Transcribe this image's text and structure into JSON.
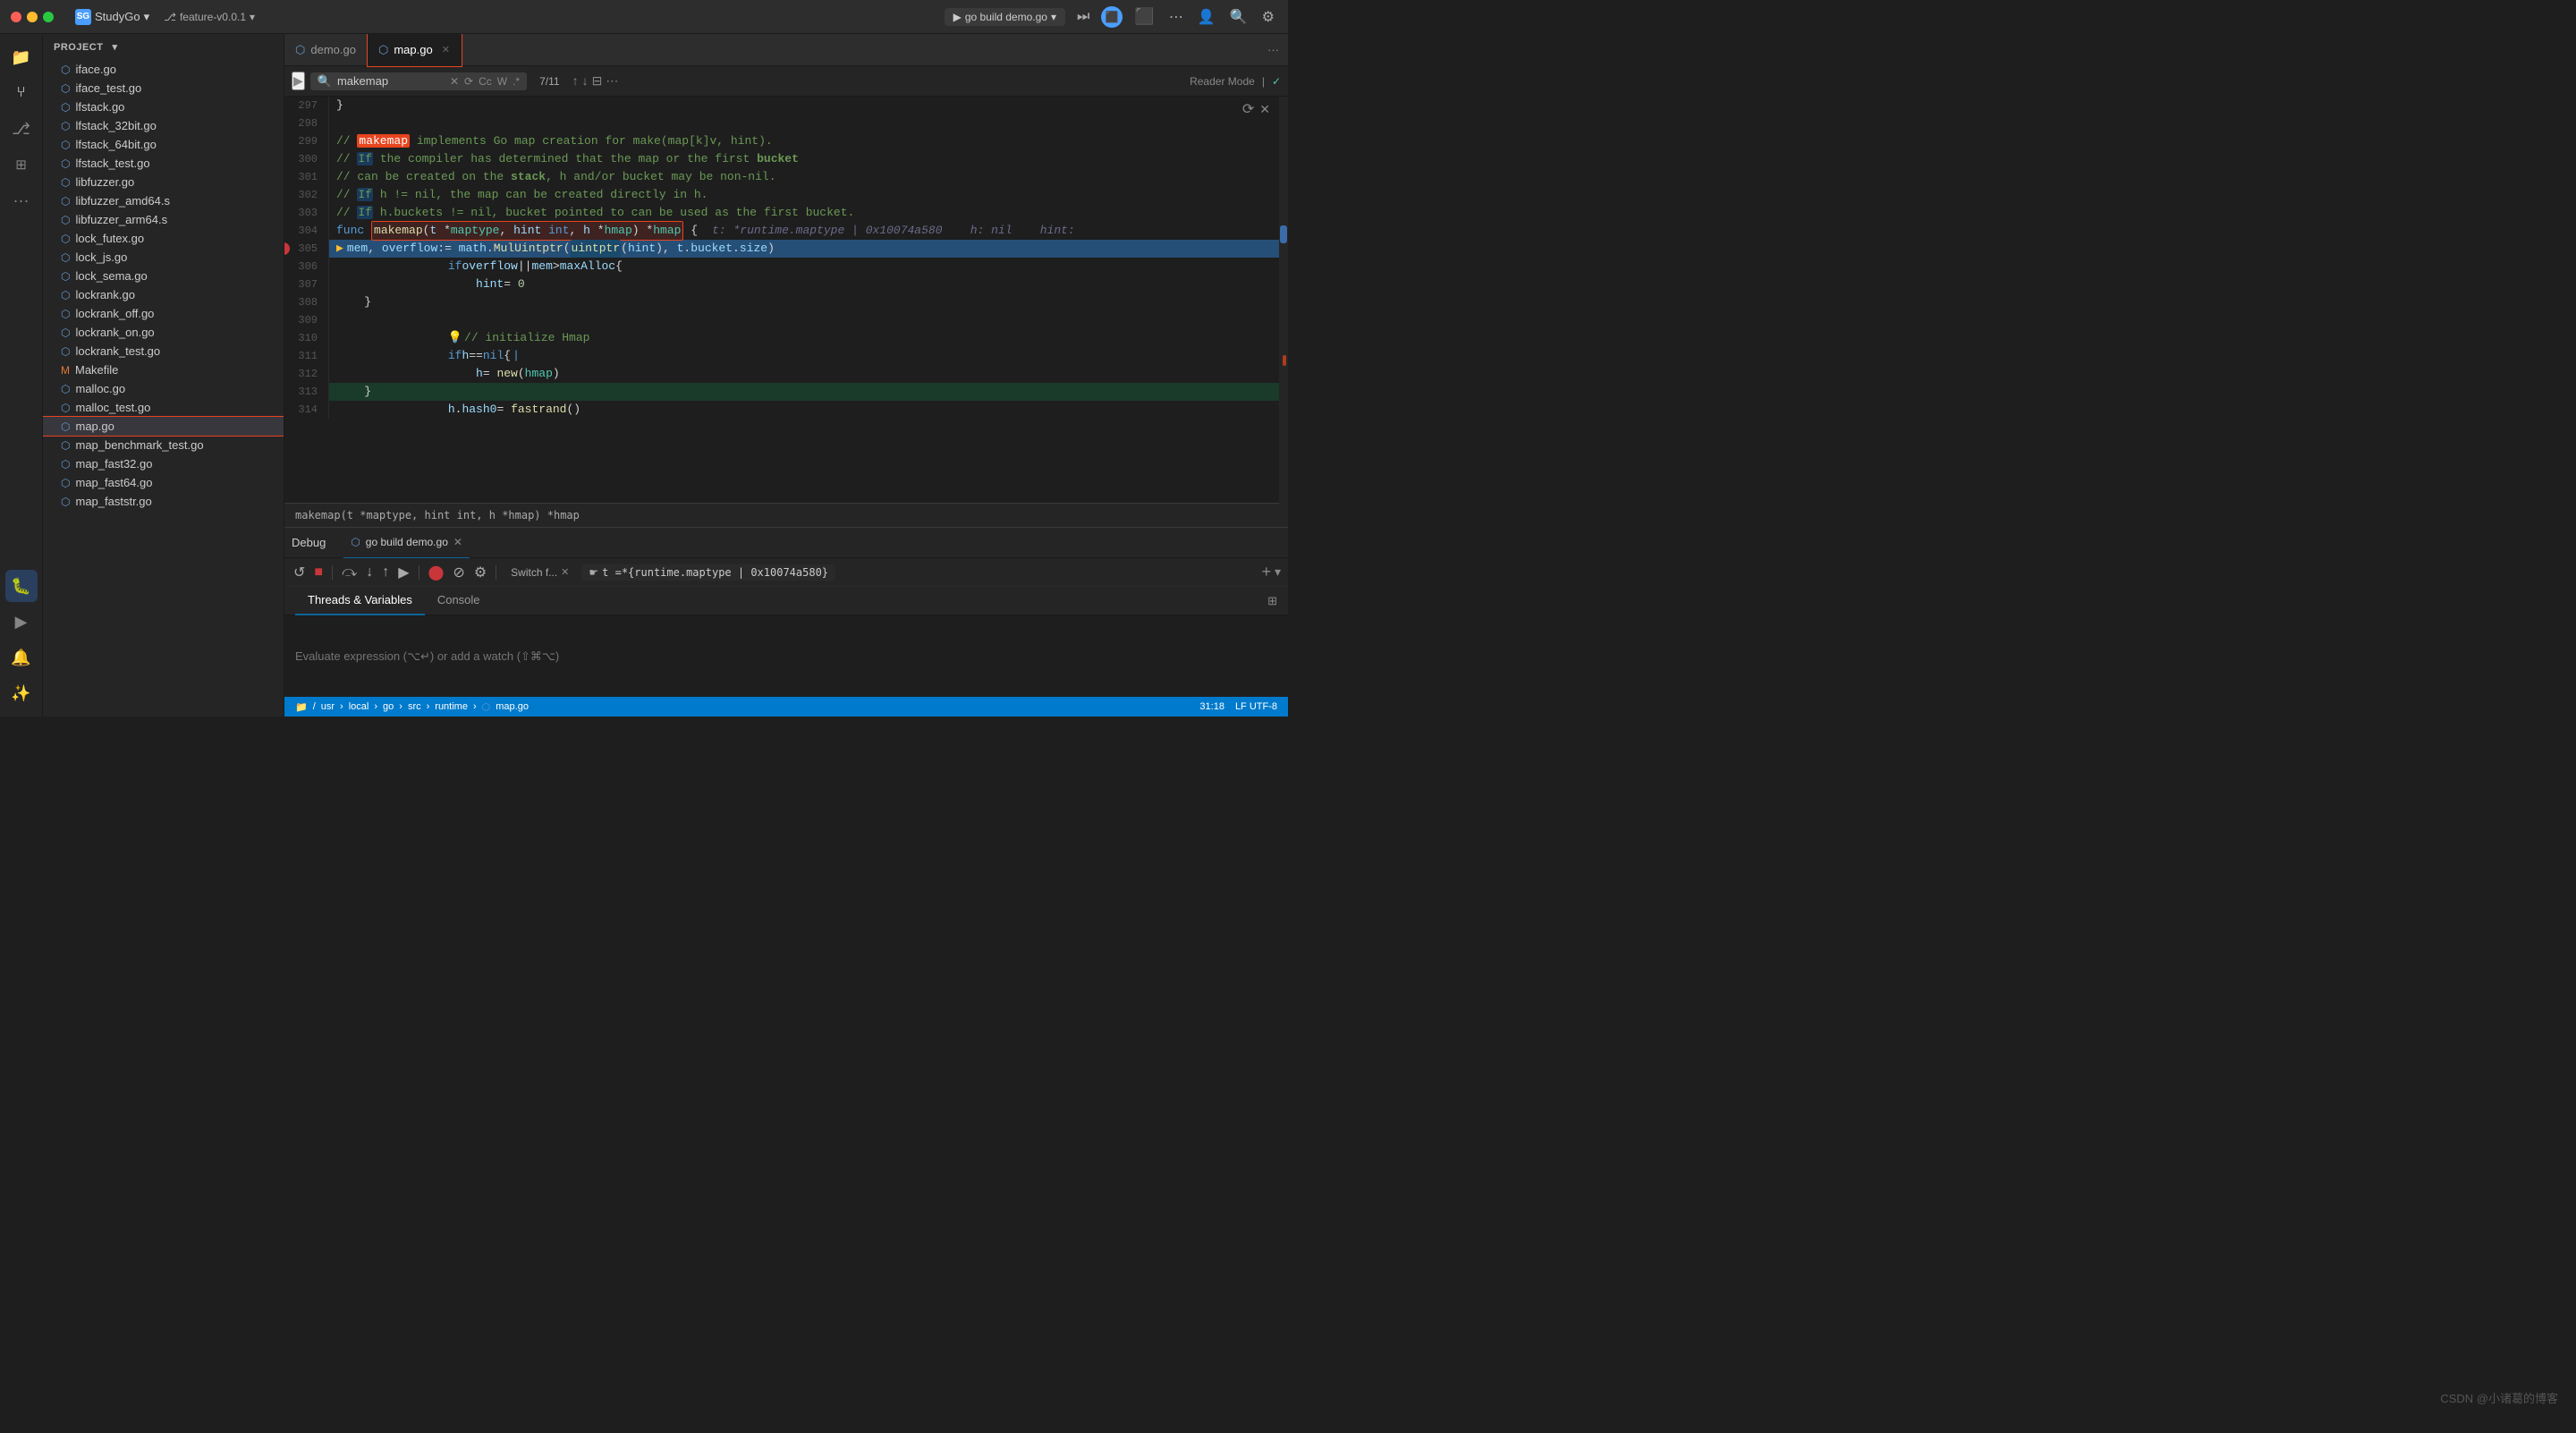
{
  "titlebar": {
    "app_name": "StudyGo",
    "branch": "feature-v0.0.1",
    "run_label": "go build demo.go",
    "chevron": "▾"
  },
  "tabs": [
    {
      "label": "demo.go",
      "active": false,
      "icon": "go"
    },
    {
      "label": "map.go",
      "active": true,
      "icon": "go",
      "highlighted": true
    }
  ],
  "search": {
    "placeholder": "makemap",
    "value": "makemap",
    "count": "7/11",
    "reader_mode": "Reader Mode"
  },
  "sidebar": {
    "header": "Project",
    "files": [
      "iface.go",
      "iface_test.go",
      "lfstack.go",
      "lfstack_32bit.go",
      "lfstack_64bit.go",
      "lfstack_test.go",
      "libfuzzer.go",
      "libfuzzer_amd64.s",
      "libfuzzer_arm64.s",
      "lock_futex.go",
      "lock_js.go",
      "lock_sema.go",
      "lockrank.go",
      "lockrank_off.go",
      "lockrank_on.go",
      "lockrank_test.go",
      "Makefile",
      "malloc.go",
      "malloc_test.go",
      "map.go",
      "map_benchmark_test.go",
      "map_fast32.go",
      "map_fast64.go",
      "map_faststr.go"
    ],
    "active_file": "map.go"
  },
  "code": {
    "lines": [
      {
        "num": 297,
        "text": "}"
      },
      {
        "num": 298,
        "text": ""
      },
      {
        "num": 299,
        "text": "// makemap implements Go map creation for make(map[k]v, hint)."
      },
      {
        "num": 300,
        "text": "// If the compiler has determined that the map or the first bucket"
      },
      {
        "num": 301,
        "text": "// can be created on the stack, h and/or bucket may be non-nil."
      },
      {
        "num": 302,
        "text": "// If h != nil, the map can be created directly in h."
      },
      {
        "num": 303,
        "text": "// If h.buckets != nil, bucket pointed to can be used as the first bucket."
      },
      {
        "num": 304,
        "text": "func makemap(t *maptype, hint int, h *hmap) *hmap {"
      },
      {
        "num": 305,
        "text": "    mem, overflow := math.MulUintptr(uintptr(hint), t.bucket.size)"
      },
      {
        "num": 306,
        "text": "    if overflow || mem > maxAlloc {"
      },
      {
        "num": 307,
        "text": "        hint = 0"
      },
      {
        "num": 308,
        "text": "    }"
      },
      {
        "num": 309,
        "text": ""
      },
      {
        "num": 310,
        "text": "    // initialize Hmap"
      },
      {
        "num": 311,
        "text": "    if h == nil {"
      },
      {
        "num": 312,
        "text": "        h = new(hmap)"
      },
      {
        "num": 313,
        "text": "    }"
      },
      {
        "num": 314,
        "text": "    h.hash0 = fastrand()"
      }
    ],
    "inline_hint": "t: *runtime.maptype | 0x10074a580    h: nil    hint:",
    "func_signature": "makemap(t *maptype, hint int, h *hmap) *hmap"
  },
  "debug": {
    "tab_label": "Debug",
    "run_tab": "go build demo.go",
    "content_tabs": [
      "Threads & Variables",
      "Console"
    ],
    "active_content_tab": "Threads & Variables",
    "console_tab": "Console",
    "eval_placeholder": "Evaluate expression (⌥↵) or add a watch (⇧⌘⌥)",
    "toolbar_buttons": [
      "restart",
      "stop",
      "step-over",
      "step-into",
      "step-out",
      "resume",
      "breakpoints",
      "mute",
      "settings"
    ],
    "switch_frames": "Switch f...",
    "frame_expr": "t =*{runtime.maptype | 0x10074a580}"
  },
  "breadcrumb": {
    "items": [
      "/",
      "usr",
      "local",
      "go",
      "src",
      "runtime",
      "map.go"
    ]
  },
  "watermark": "CSDN @小诸葛的博客",
  "status": {
    "line": "31:18",
    "encoding": "LF UTF-8"
  }
}
